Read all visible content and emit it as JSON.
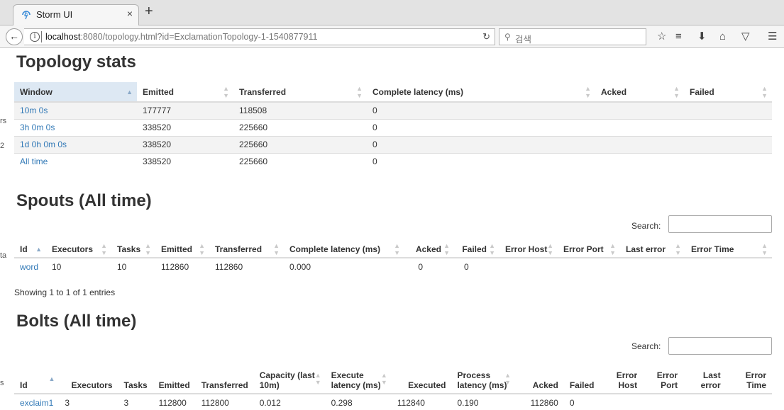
{
  "browser": {
    "tab_title": "Storm UI",
    "tab_close": "×",
    "new_tab": "+",
    "url_host": "localhost",
    "url_rest": ":8080/topology.html?id=ExclamationTopology-1-1540877911",
    "search_placeholder": "검색",
    "icons": [
      "back-arrow-icon",
      "info-icon",
      "reload-icon",
      "search-icon",
      "bookmark-star-icon",
      "reading-list-icon",
      "download-icon",
      "home-icon",
      "pocket-icon",
      "menu-icon"
    ]
  },
  "left_edge": [
    "rs",
    "2",
    "ta",
    "s"
  ],
  "topology_stats": {
    "title": "Topology stats",
    "columns": [
      "Window",
      "Emitted",
      "Transferred",
      "Complete latency (ms)",
      "Acked",
      "Failed"
    ],
    "rows": [
      [
        "10m 0s",
        "177777",
        "118508",
        "0",
        "",
        ""
      ],
      [
        "3h 0m 0s",
        "338520",
        "225660",
        "0",
        "",
        ""
      ],
      [
        "1d 0h 0m 0s",
        "338520",
        "225660",
        "0",
        "",
        ""
      ],
      [
        "All time",
        "338520",
        "225660",
        "0",
        "",
        ""
      ]
    ]
  },
  "spouts": {
    "title": "Spouts (All time)",
    "search_label": "Search:",
    "columns": [
      "Id",
      "Executors",
      "Tasks",
      "Emitted",
      "Transferred",
      "Complete latency (ms)",
      "Acked",
      "Failed",
      "Error Host",
      "Error Port",
      "Last error",
      "Error Time"
    ],
    "rows": [
      [
        "word",
        "10",
        "10",
        "112860",
        "112860",
        "0.000",
        "0",
        "0",
        "",
        "",
        "",
        ""
      ]
    ],
    "info": "Showing 1 to 1 of 1 entries"
  },
  "bolts": {
    "title": "Bolts (All time)",
    "search_label": "Search:",
    "columns": [
      "Id",
      "Executors",
      "Tasks",
      "Emitted",
      "Transferred",
      "Capacity (last 10m)",
      "Execute latency (ms)",
      "Executed",
      "Process latency (ms)",
      "Acked",
      "Failed",
      "Error Host",
      "Error Port",
      "Last error",
      "Error Time"
    ],
    "rows": [
      [
        "exclaim1",
        "3",
        "3",
        "112800",
        "112800",
        "0.012",
        "0.298",
        "112840",
        "0.190",
        "112860",
        "0",
        "",
        "",
        "",
        ""
      ]
    ]
  }
}
